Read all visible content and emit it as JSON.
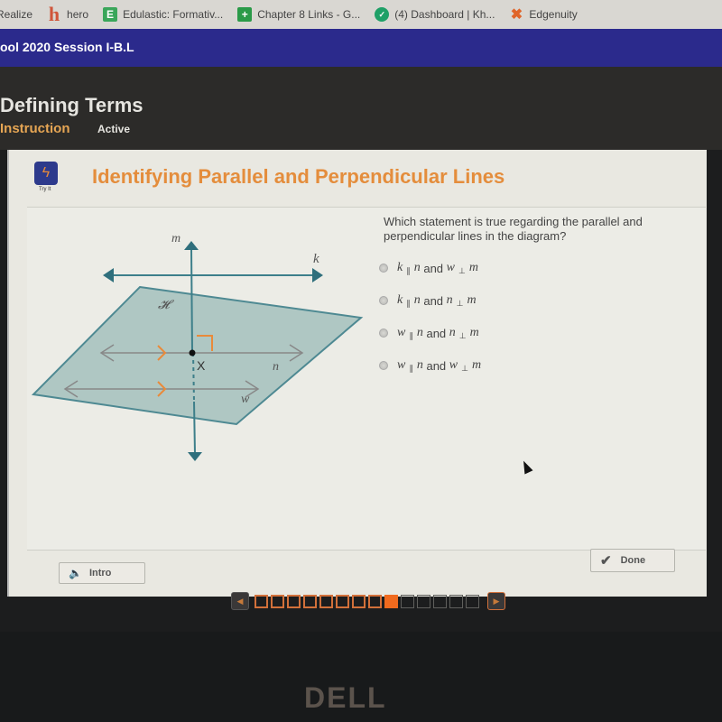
{
  "bookmarks": [
    {
      "icon": "realize-icon",
      "glyph": "",
      "label": "Realize"
    },
    {
      "icon": "hero-icon",
      "glyph": "h",
      "label": "hero"
    },
    {
      "icon": "edulastic-icon",
      "glyph": "E",
      "label": "Edulastic: Formativ..."
    },
    {
      "icon": "classroom-icon",
      "glyph": "+",
      "label": "Chapter 8 Links - G..."
    },
    {
      "icon": "khan-academy-icon",
      "glyph": "✓",
      "label": "(4) Dashboard | Kh..."
    },
    {
      "icon": "edgenuity-icon",
      "glyph": "✖",
      "label": "Edgenuity"
    }
  ],
  "course": {
    "title": "ool 2020 Session I-B.L"
  },
  "lesson": {
    "title": "Defining Terms",
    "tab_instruction": "Instruction",
    "tab_active": "Active"
  },
  "activity": {
    "tryit_label": "Try It",
    "title": "Identifying Parallel and Perpendicular Lines",
    "accent_color": "#e48d3c"
  },
  "diagram": {
    "labels": {
      "m": "m",
      "k": "k",
      "plane": "𝓗",
      "point": "X",
      "n": "n",
      "w": "w"
    }
  },
  "question": {
    "text": "Which statement is true regarding the parallel and perpendicular lines in the diagram?",
    "options": [
      {
        "a": "k",
        "rel1": "∥",
        "b": "n",
        "and": "and",
        "c": "w",
        "rel2": "⊥",
        "d": "m",
        "selected": false
      },
      {
        "a": "k",
        "rel1": "∥",
        "b": "n",
        "and": "and",
        "c": "n",
        "rel2": "⊥",
        "d": "m",
        "selected": false
      },
      {
        "a": "w",
        "rel1": "∥",
        "b": "n",
        "and": "and",
        "c": "n",
        "rel2": "⊥",
        "d": "m",
        "selected": false
      },
      {
        "a": "w",
        "rel1": "∥",
        "b": "n",
        "and": "and",
        "c": "w",
        "rel2": "⊥",
        "d": "m",
        "selected": false
      }
    ]
  },
  "buttons": {
    "intro": "Intro",
    "done": "Done"
  },
  "pager": {
    "total": 14,
    "current": 9,
    "completed": 8
  },
  "brand": {
    "monitor": "DELL"
  }
}
